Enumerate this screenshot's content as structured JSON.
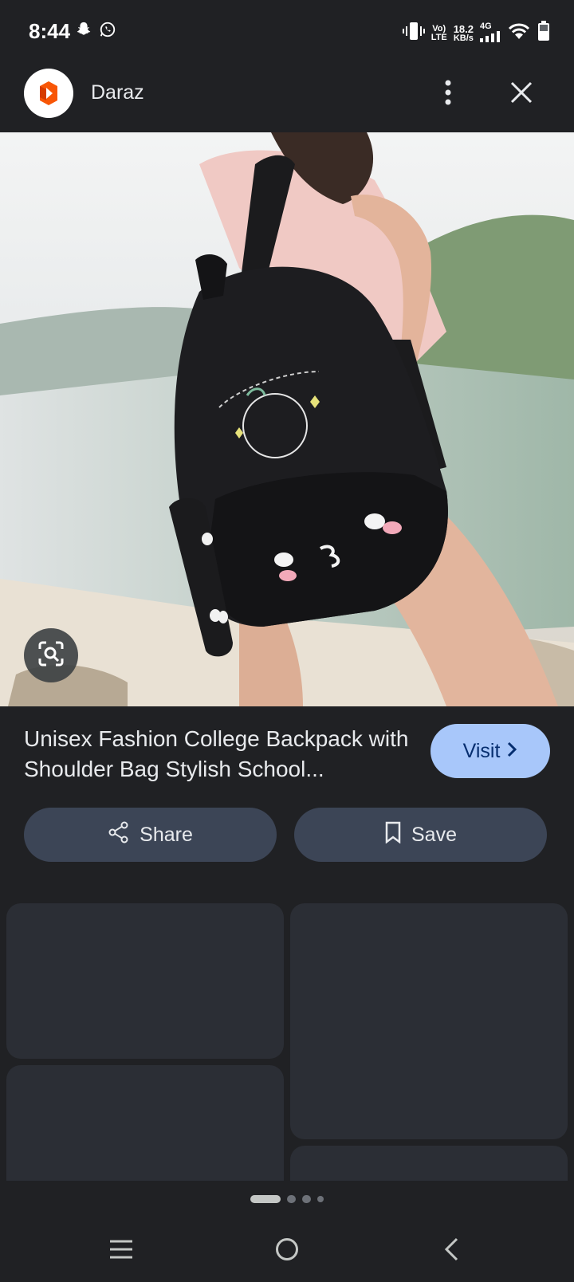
{
  "status": {
    "time": "8:44",
    "volte": "Vo)",
    "lte": "LTE",
    "speed_value": "18.2",
    "speed_unit": "KB/s",
    "network": "4G",
    "icons": [
      "snapchat-icon",
      "whatsapp-icon",
      "vibrate-icon",
      "signal-icon",
      "wifi-icon",
      "battery-icon"
    ]
  },
  "header": {
    "site_name": "Daraz",
    "icons": [
      "daraz-logo-icon",
      "more-vert-icon",
      "close-icon"
    ]
  },
  "product": {
    "title": "Unisex Fashion College Backpack with Shoulder Bag Stylish School...",
    "visit_label": "Visit",
    "image_alt": "black backpack with face print"
  },
  "actions": {
    "share_label": "Share",
    "save_label": "Save"
  },
  "pager": {
    "count": 4,
    "active_index": 0
  },
  "colors": {
    "background": "#202124",
    "visit_button": "#a8c7fa",
    "action_button": "#3c4556",
    "card": "#2b2e35",
    "daraz_orange": "#f85606"
  },
  "navigation": [
    "menu-icon",
    "home-icon",
    "back-icon"
  ]
}
